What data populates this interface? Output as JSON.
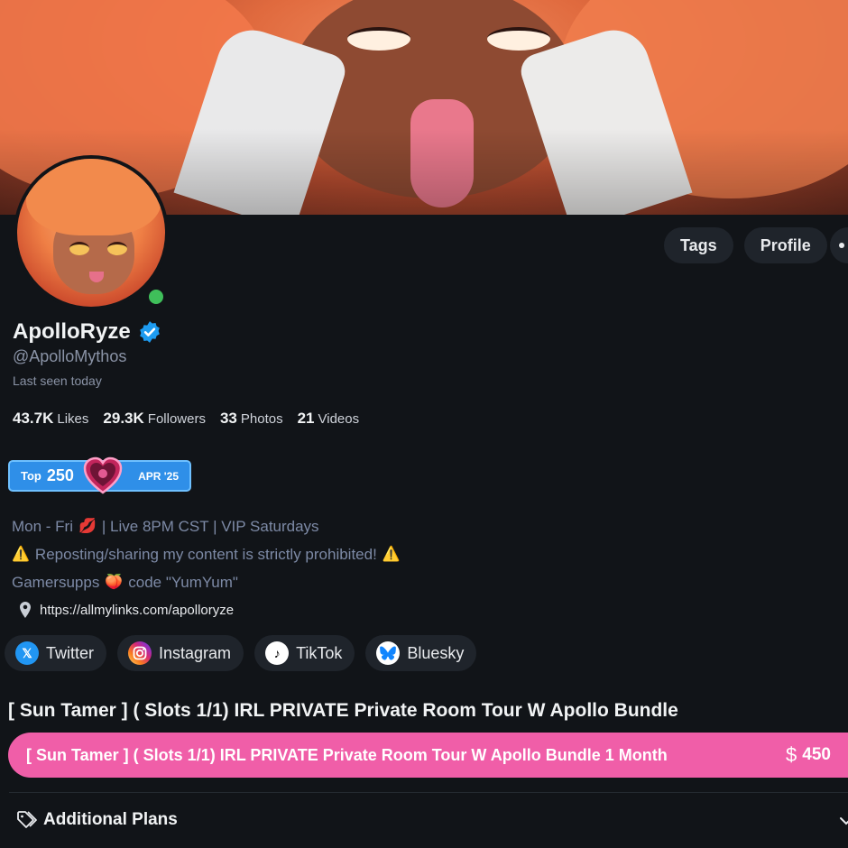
{
  "profile": {
    "name": "ApolloRyze",
    "handle": "@ApolloMythos",
    "last_seen": "Last seen today",
    "online": true
  },
  "header_buttons": {
    "tags": "Tags",
    "profile": "Profile"
  },
  "stats": [
    {
      "value": "43.7K",
      "label": "Likes"
    },
    {
      "value": "29.3K",
      "label": "Followers"
    },
    {
      "value": "33",
      "label": "Photos"
    },
    {
      "value": "21",
      "label": "Videos"
    }
  ],
  "badge": {
    "label": "Top",
    "rank": "250",
    "date": "APR '25"
  },
  "bio": {
    "line1_a": "Mon - Fri",
    "line1_b": "| Live 8PM CST | VIP Saturdays",
    "line2": "Reposting/sharing my content is strictly prohibited!",
    "line3_a": "Gamersupps",
    "line3_b": "code \"YumYum\""
  },
  "link": "https://allmylinks.com/apolloryze",
  "socials": [
    {
      "label": "Twitter",
      "icon": "x-icon"
    },
    {
      "label": "Instagram",
      "icon": "instagram-icon"
    },
    {
      "label": "TikTok",
      "icon": "tiktok-icon"
    },
    {
      "label": "Bluesky",
      "icon": "bluesky-icon"
    }
  ],
  "bundle": {
    "title": "[ Sun Tamer ] ( Slots 1/1) IRL PRIVATE Private Room Tour W Apollo Bundle",
    "button_label": "[ Sun Tamer ] ( Slots 1/1) IRL PRIVATE Private Room Tour W Apollo Bundle 1 Month",
    "currency_symbol": "$",
    "price": "450"
  },
  "additional_plans": "Additional Plans",
  "colors": {
    "background": "#111418",
    "accent_pink": "#f05ea8",
    "badge_blue": "#2f8fe8",
    "verified_blue": "#1d9bf0",
    "online_green": "#3fbf5a"
  }
}
